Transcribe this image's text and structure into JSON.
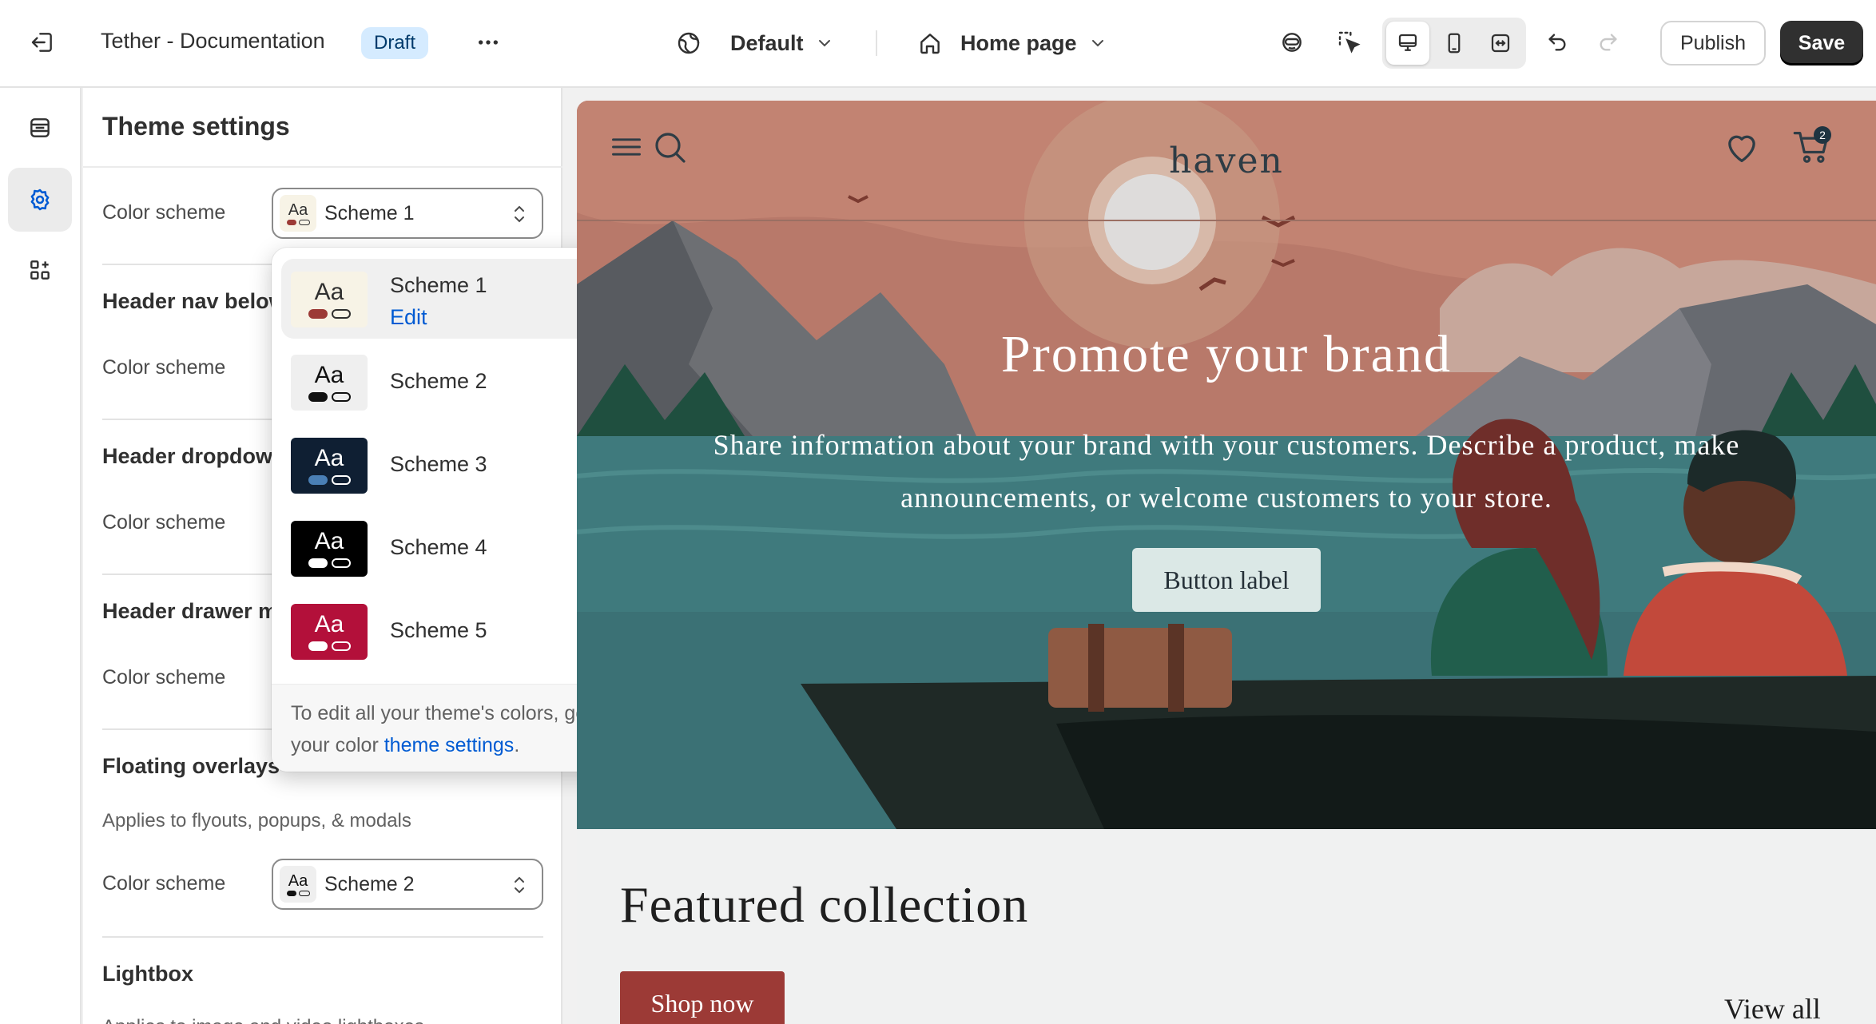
{
  "topbar": {
    "store_title": "Tether - Documentation",
    "status_badge": "Draft",
    "theme_selector": "Default",
    "page_selector": "Home page",
    "publish_label": "Publish",
    "save_label": "Save"
  },
  "panel": {
    "title": "Theme settings",
    "color_scheme_label": "Color scheme",
    "main_select_value": "Scheme 1",
    "sections": [
      {
        "title": "Header nav below",
        "label": "Color scheme"
      },
      {
        "title": "Header dropdown",
        "label": "Color scheme"
      },
      {
        "title": "Header drawer m",
        "label": "Color scheme"
      },
      {
        "title": "Floating overlays",
        "help": "Applies to flyouts, popups, & modals",
        "label": "Color scheme",
        "value": "Scheme 2"
      },
      {
        "title": "Lightbox",
        "help": "Applies to image and video lightboxes"
      }
    ]
  },
  "dropdown": {
    "options": [
      {
        "name": "Scheme 1",
        "action": "Edit",
        "selected": true,
        "bg": "#f7f3e6",
        "fg": "#303030",
        "fill": "#9c3a36",
        "outline": "#303030"
      },
      {
        "name": "Scheme 2",
        "selected": false,
        "bg": "#efefef",
        "fg": "#111111",
        "fill": "#111111",
        "outline": "#111111"
      },
      {
        "name": "Scheme 3",
        "selected": false,
        "bg": "#0f1f33",
        "fg": "#ffffff",
        "fill": "#4a7fb5",
        "outline": "#ffffff"
      },
      {
        "name": "Scheme 4",
        "selected": false,
        "bg": "#000000",
        "fg": "#ffffff",
        "fill": "#ffffff",
        "outline": "#ffffff"
      },
      {
        "name": "Scheme 5",
        "selected": false,
        "bg": "#b3103a",
        "fg": "#ffffff",
        "fill": "#ffffff",
        "outline": "#ffffff"
      }
    ],
    "footer_text": "To edit all your theme's colors, go to your color ",
    "footer_link": "theme settings",
    "footer_end": "."
  },
  "preview": {
    "brand": "haven",
    "cart_count": "2",
    "hero_title": "Promote your brand",
    "hero_text": "Share information about your brand with your customers. Describe a product, make announcements, or welcome customers to your store.",
    "hero_button": "Button label",
    "collection_title": "Featured collection",
    "shop_button": "Shop now",
    "view_all": "View all"
  },
  "colors": {
    "accent_link": "#005bd3",
    "save_bg": "#303030",
    "shop_button": "#9c3a36"
  }
}
